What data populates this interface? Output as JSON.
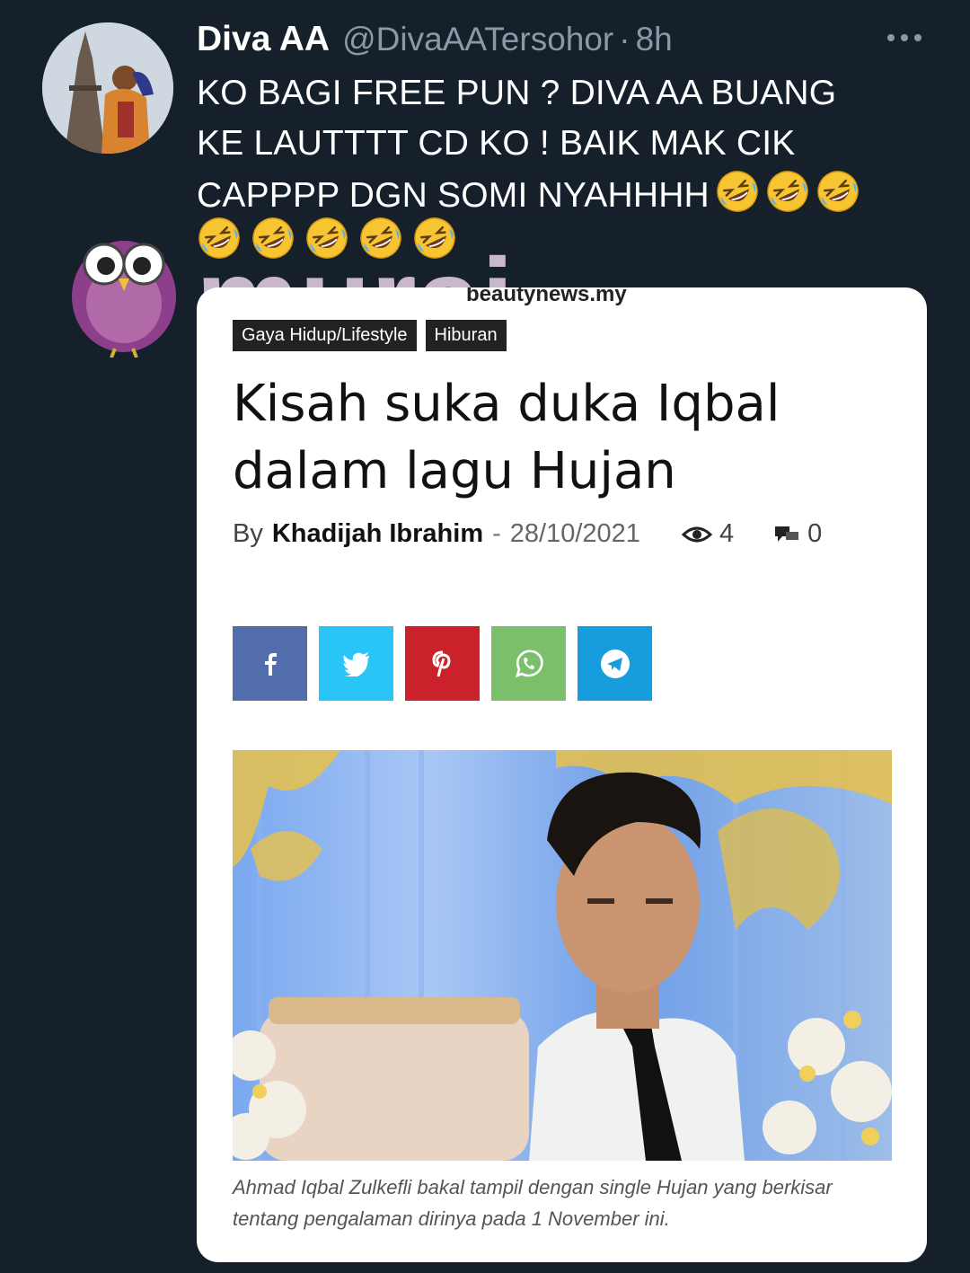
{
  "tweet": {
    "author_name": "Diva AA",
    "handle": "@DivaAATersohor",
    "separator": "·",
    "time": "8h",
    "more_icon": "more-horizontal-icon",
    "text_lines": [
      "KO BAGI FREE PUN ? DIVA AA BUANG",
      "KE LAUTTTT CD KO ! BAIK MAK CIK",
      "CAPPPP DGN SOMI NYAHHHH"
    ],
    "emoji_name": "rolling-on-floor-laughing-emoji",
    "emoji_count_line3": 3,
    "emoji_count_line4": 5
  },
  "watermark": {
    "text": "murai",
    "logo": "owl-logo"
  },
  "article": {
    "site": "beautynews.my",
    "categories": [
      "Gaya Hidup/Lifestyle",
      "Hiburan"
    ],
    "headline_line1": "Kisah suka duka Iqbal",
    "headline_line2": "dalam lagu Hujan",
    "by_label": "By",
    "author": "Khadijah Ibrahim",
    "meta_sep": "-",
    "date": "28/10/2021",
    "views": "4",
    "comments": "0",
    "share_buttons": [
      {
        "name": "facebook",
        "color": "#516eab",
        "icon": "facebook-icon"
      },
      {
        "name": "twitter",
        "color": "#29c5f6",
        "icon": "twitter-icon"
      },
      {
        "name": "pinterest",
        "color": "#ca212a",
        "icon": "pinterest-icon"
      },
      {
        "name": "whatsapp",
        "color": "#7bbf6a",
        "icon": "whatsapp-icon"
      },
      {
        "name": "telegram",
        "color": "#179cde",
        "icon": "telegram-icon"
      }
    ],
    "caption_line1": "Ahmad Iqbal Zulkefli bakal tampil dengan single Hujan yang berkisar",
    "caption_line2": "tentang pengalaman dirinya pada 1 November ini."
  },
  "colors": {
    "background": "#15202b",
    "muted": "#8b98a5"
  }
}
